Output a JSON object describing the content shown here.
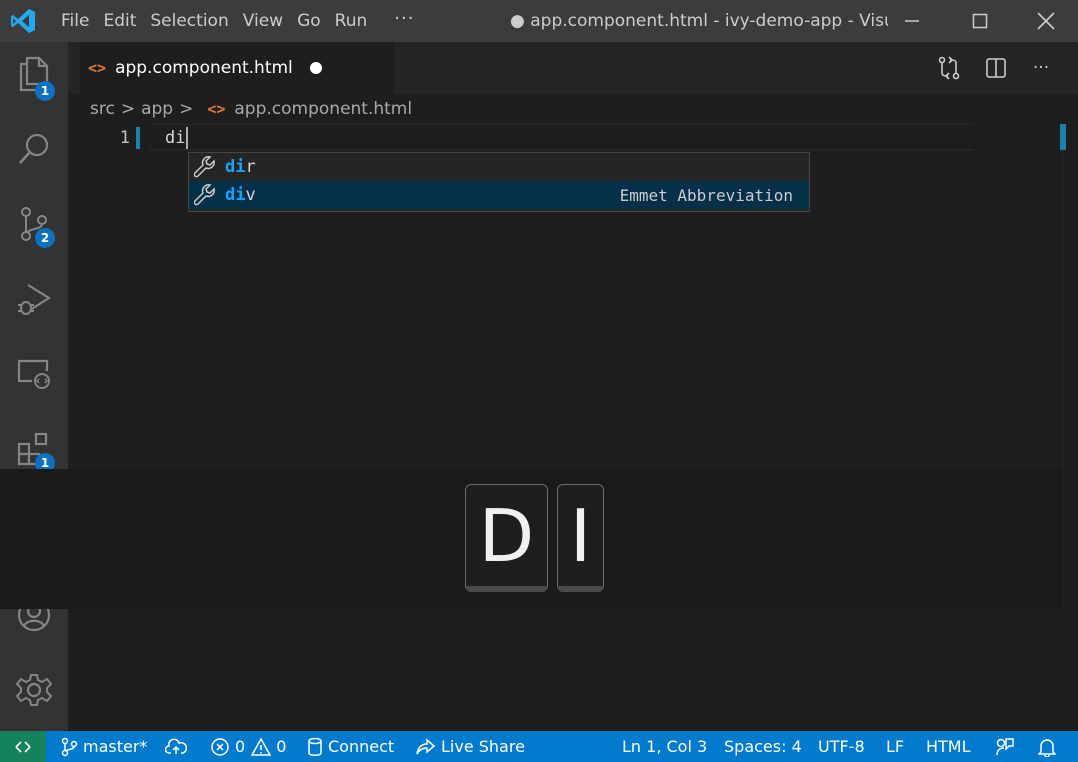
{
  "titlebar": {
    "menu": [
      "File",
      "Edit",
      "Selection",
      "View",
      "Go",
      "Run"
    ],
    "more": "···",
    "window_title": "● app.component.html - ivy-demo-app - Visua..."
  },
  "activitybar": {
    "explorer_badge": "1",
    "scm_badge": "2",
    "extensions_badge": "1",
    "more": "···"
  },
  "tab": {
    "icon": "<>",
    "label": "app.component.html"
  },
  "breadcrumb": {
    "parts": [
      "src",
      "app"
    ],
    "sep": ">",
    "file_icon": "<>",
    "file": "app.component.html"
  },
  "editor": {
    "line_number": "1",
    "line_text": "di"
  },
  "suggest": {
    "items": [
      {
        "match": "di",
        "rest": "r",
        "detail": ""
      },
      {
        "match": "di",
        "rest": "v",
        "detail": "Emmet Abbreviation"
      }
    ],
    "selected_index": 1
  },
  "keys": [
    "D",
    "I"
  ],
  "statusbar": {
    "branch": "master*",
    "errors": "0",
    "warnings": "0",
    "connect": "Connect",
    "live_share": "Live Share",
    "position": "Ln 1, Col 3",
    "spaces": "Spaces: 4",
    "encoding": "UTF-8",
    "eol": "LF",
    "language": "HTML"
  },
  "colors": {
    "accent": "#007acc",
    "remote": "#16825d",
    "badge": "#0e70c0",
    "match": "#18a3ff",
    "html_icon": "#e37933"
  }
}
